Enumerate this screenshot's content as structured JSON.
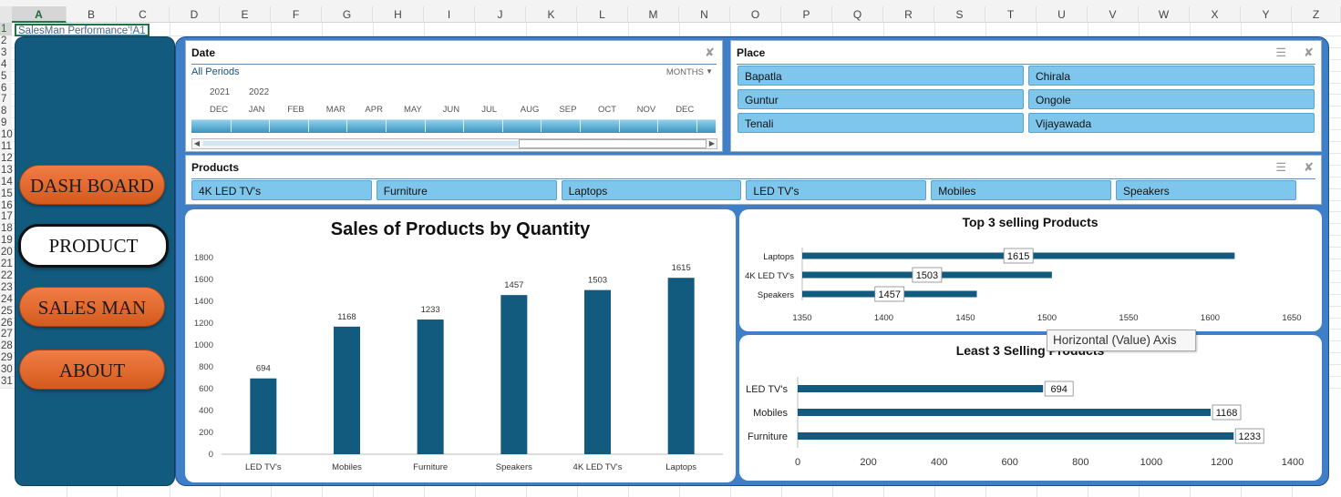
{
  "spreadsheet": {
    "columns": [
      "A",
      "B",
      "C",
      "D",
      "E",
      "F",
      "G",
      "H",
      "I",
      "J",
      "K",
      "L",
      "M",
      "N",
      "O",
      "P",
      "Q",
      "R",
      "S",
      "T",
      "U",
      "V",
      "W",
      "X",
      "Y",
      "Z"
    ],
    "rows": [
      "1",
      "2",
      "3",
      "4",
      "5",
      "6",
      "7",
      "8",
      "9",
      "10",
      "11",
      "12",
      "13",
      "14",
      "15",
      "16",
      "17",
      "18",
      "19",
      "20",
      "21",
      "22",
      "23",
      "24",
      "25",
      "26",
      "27",
      "28",
      "29",
      "30",
      "31"
    ],
    "selected_column": "A",
    "selected_row": "1",
    "cell_a1_part1": "SalesMan",
    "cell_a1_part2": " Performance'!A1"
  },
  "nav": {
    "dashboard": "DASH BOARD",
    "product": "PRODUCT",
    "salesman": "SALES MAN",
    "about": "ABOUT"
  },
  "date_slicer": {
    "title": "Date",
    "period": "All Periods",
    "granularity": "MONTHS",
    "years": [
      "2021",
      "2022"
    ],
    "months": [
      "DEC",
      "JAN",
      "FEB",
      "MAR",
      "APR",
      "MAY",
      "JUN",
      "JUL",
      "AUG",
      "SEP",
      "OCT",
      "NOV",
      "DEC"
    ]
  },
  "place_slicer": {
    "title": "Place",
    "items": [
      "Bapatla",
      "Chirala",
      "Guntur",
      "Ongole",
      "Tenali",
      "Vijayawada"
    ]
  },
  "products_slicer": {
    "title": "Products",
    "items": [
      "4K LED TV's",
      "Furniture",
      "Laptops",
      "LED TV's",
      "Mobiles",
      "Speakers"
    ]
  },
  "tooltip": "Horizontal (Value) Axis",
  "colors": {
    "bar": "#125b7f",
    "navy": "#125b7f",
    "orange": "#e06a2c",
    "tile": "#7fc6ec",
    "panel": "#3f7fc8"
  },
  "chart_data": [
    {
      "type": "bar",
      "title": "Sales of Products by Quantity",
      "categories": [
        "LED TV's",
        "Mobiles",
        "Furniture",
        "Speakers",
        "4K LED TV's",
        "Laptops"
      ],
      "values": [
        694,
        1168,
        1233,
        1457,
        1503,
        1615
      ],
      "yticks": [
        "0",
        "200",
        "400",
        "600",
        "800",
        "1000",
        "1200",
        "1400",
        "1600",
        "1800"
      ],
      "ylim": [
        0,
        1800
      ]
    },
    {
      "type": "bar",
      "orientation": "horizontal",
      "title": "Top 3 selling Products",
      "categories": [
        "Laptops",
        "4K LED TV's",
        "Speakers"
      ],
      "values": [
        1615,
        1503,
        1457
      ],
      "xticks": [
        "1350",
        "1400",
        "1450",
        "1500",
        "1550",
        "1600",
        "1650"
      ],
      "xlim": [
        1350,
        1650
      ]
    },
    {
      "type": "bar",
      "orientation": "horizontal",
      "title": "Least 3 Selling Products",
      "categories": [
        "LED TV's",
        "Mobiles",
        "Furniture"
      ],
      "values": [
        694,
        1168,
        1233
      ],
      "xticks": [
        "0",
        "200",
        "400",
        "600",
        "800",
        "1000",
        "1200",
        "1400"
      ],
      "xlim": [
        0,
        1400
      ]
    }
  ]
}
